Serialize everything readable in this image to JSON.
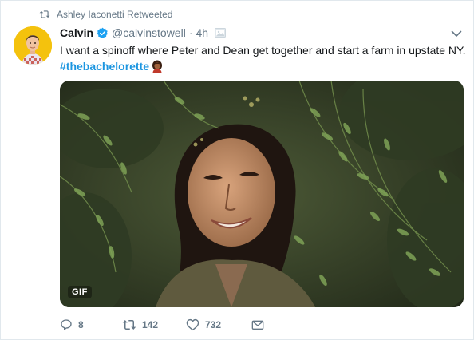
{
  "retweet": {
    "icon": "retweet-icon",
    "text": "Ashley Iaconetti Retweeted"
  },
  "author": {
    "name": "Calvin",
    "verified": true,
    "handle": "@calvinstowell",
    "separator": "·",
    "time": "4h"
  },
  "tweet": {
    "text": "I want a spinoff where Peter and Dean get together and start a farm in upstate NY.",
    "hashtag": "#thebachelorette",
    "emoji": "woman-emoji"
  },
  "media": {
    "type": "gif",
    "badge": "GIF"
  },
  "actions": {
    "reply_count": "8",
    "retweet_count": "142",
    "like_count": "732"
  },
  "colors": {
    "accent": "#1da1f2",
    "hashtag": "#1b95e0",
    "muted": "#657786",
    "avatar_bg": "#f4c20d"
  }
}
